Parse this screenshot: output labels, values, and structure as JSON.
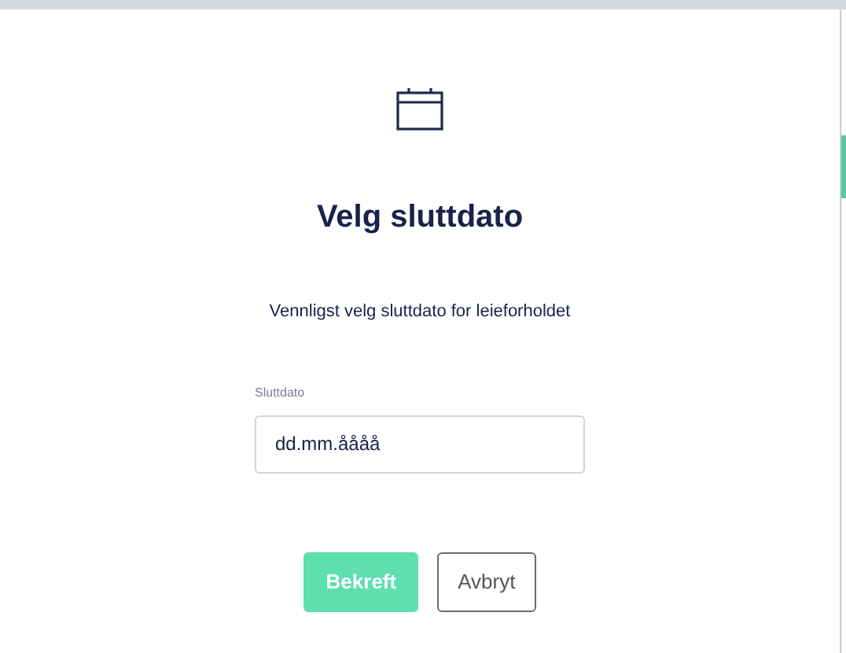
{
  "dialog": {
    "title": "Velg sluttdato",
    "message": "Vennligst velg sluttdato for leieforholdet",
    "field": {
      "label": "Sluttdato",
      "placeholder": "dd.mm.åååå"
    },
    "buttons": [
      {
        "label": "Bekreft",
        "kind": "primary"
      },
      {
        "label": "Avbryt",
        "kind": "secondary"
      }
    ]
  }
}
